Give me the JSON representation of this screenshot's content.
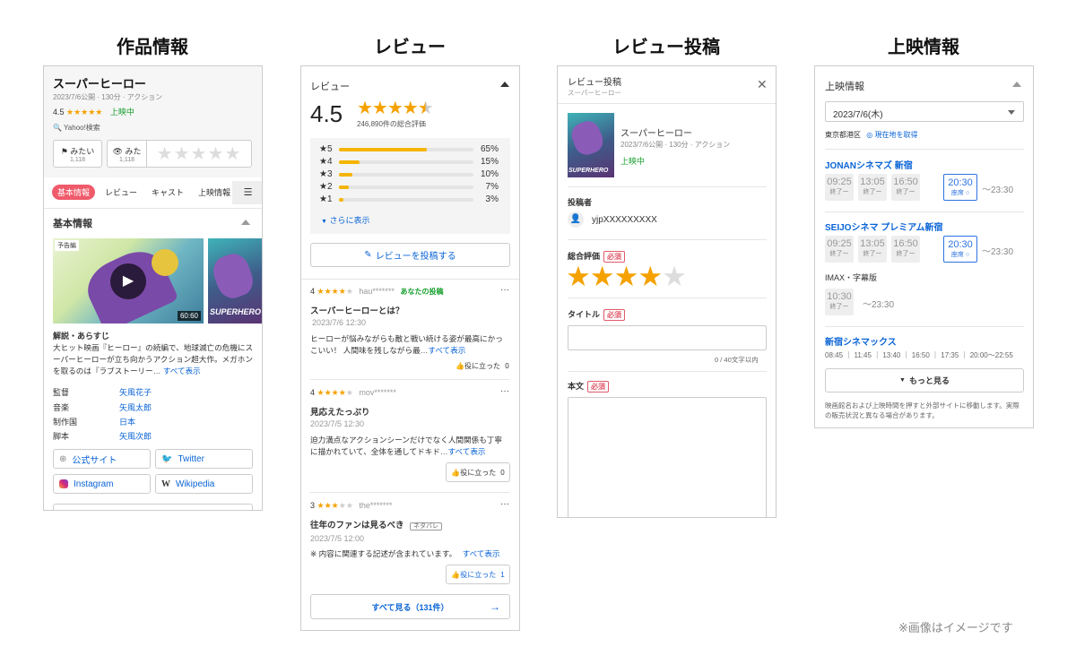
{
  "columns": {
    "info": "作品情報",
    "reviews": "レビュー",
    "post": "レビュー投稿",
    "showings": "上映情報"
  },
  "info_panel": {
    "title": "スーパーヒーロー",
    "meta": "2023/7/6公開 · 130分 · アクション",
    "rating": "4.5",
    "status": "上映中",
    "yahoo_search": "Yahoo!検索",
    "want_label": "みたい",
    "want_count": "1,118",
    "seen_label": "みた",
    "seen_count": "1,118",
    "tabs": [
      "基本情報",
      "レビュー",
      "キャスト",
      "上映情報"
    ],
    "section_title": "基本情報",
    "trailer_badge": "予告編",
    "duration": "60:60",
    "poster_text": "SUPERHERO",
    "synopsis_title": "解説・あらすじ",
    "synopsis": "大ヒット映画『ヒーロー』の続編で、地球滅亡の危機にスーパーヒーローが立ち向かうアクション超大作。メガホンを取るのは『ラブストーリー…",
    "show_all": "すべて表示",
    "credits": [
      {
        "role": "監督",
        "name": "矢風花子"
      },
      {
        "role": "音楽",
        "name": "矢風太郎"
      },
      {
        "role": "制作国",
        "name": "日本"
      },
      {
        "role": "脚本",
        "name": "矢風次郎"
      }
    ],
    "links": [
      "公式サイト",
      "Twitter",
      "Instagram",
      "Wikipedia"
    ]
  },
  "review_panel": {
    "header": "レビュー",
    "score": "4.5",
    "total": "246,890件の総合評価",
    "distribution": [
      {
        "label": "★5",
        "pct": 65,
        "text": "65%"
      },
      {
        "label": "★4",
        "pct": 15,
        "text": "15%"
      },
      {
        "label": "★3",
        "pct": 10,
        "text": "10%"
      },
      {
        "label": "★2",
        "pct": 7,
        "text": "7%"
      },
      {
        "label": "★1",
        "pct": 3,
        "text": "3%"
      }
    ],
    "more": "さらに表示",
    "post_button": "レビューを投稿する",
    "reviews": [
      {
        "score": "4",
        "stars": 4,
        "user": "hau*******",
        "tag": "あなたの投稿",
        "title": "スーパーヒーローとは？",
        "date": "2023/7/6 12:30",
        "body1": "ヒーローが悩みながらも敵と戦い続ける姿が最高にかっこいい！ 人間味を残しながら最…",
        "show_all": "すべて表示",
        "helpful": "役に立った",
        "helpful_count": "0"
      },
      {
        "score": "4",
        "stars": 4,
        "user": "mov*******",
        "tag": "",
        "title": "見応えたっぷり",
        "date": "2023/7/5 12:30",
        "body1": "迫力満点なアクションシーンだけでなく人間関係も丁寧に描かれていて、全体を通してドキド…",
        "show_all": "すべて表示",
        "helpful": "役に立った",
        "helpful_count": "0"
      },
      {
        "score": "3",
        "stars": 3,
        "user": "the*******",
        "tag": "ネタバレ",
        "title": "往年のファンは見るべき",
        "date": "2023/7/5 12:00",
        "body1": "※ 内容に関連する記述が含まれています。",
        "show_all": "すべて表示",
        "helpful": "役に立った",
        "helpful_count": "1"
      }
    ],
    "see_all": "すべて見る（131件）"
  },
  "post_panel": {
    "header": "レビュー投稿",
    "subheader": "スーパーヒーロー",
    "title": "スーパーヒーロー",
    "meta": "2023/7/6公開 · 130分 · アクション",
    "status": "上映中",
    "poster_text": "SUPERHERO",
    "author_label": "投稿者",
    "author": "yjpXXXXXXXXX",
    "rating_label": "総合評価",
    "required": "必須",
    "rating_stars": 4,
    "title_label": "タイトル",
    "counter": "0 / 40文字以内",
    "body_label": "本文"
  },
  "showing_panel": {
    "header": "上映情報",
    "date": "2023/7/6(木)",
    "location": "東京都港区",
    "geo": "現在地を取得",
    "theaters": [
      {
        "name": "JONANシネマズ 新宿",
        "times": [
          {
            "t": "09:25",
            "s": "終了ー",
            "on": false
          },
          {
            "t": "13:05",
            "s": "終了ー",
            "on": false
          },
          {
            "t": "16:50",
            "s": "終了ー",
            "on": false
          },
          {
            "t": "20:30",
            "s": "座席 ○",
            "on": true
          }
        ],
        "end": "〜23:30"
      },
      {
        "name": "SEIJOシネマ プレミアム新宿",
        "times": [
          {
            "t": "09:25",
            "s": "終了ー",
            "on": false
          },
          {
            "t": "13:05",
            "s": "終了ー",
            "on": false
          },
          {
            "t": "16:50",
            "s": "終了ー",
            "on": false
          },
          {
            "t": "20:30",
            "s": "座席 ○",
            "on": true
          }
        ],
        "end": "〜23:30"
      }
    ],
    "imax_label": "IMAX・字幕版",
    "imax_time": "10:30",
    "imax_sub": "終了ー",
    "imax_end": "〜23:30",
    "third_theater": "新宿シネマックス",
    "third_times": "08:45 ｜ 11:45 ｜ 13:40 ｜ 16:50 ｜ 17:35 ｜ 20:00〜22:55",
    "more": "もっと見る",
    "note": "映画館名および上映時間を押すと外部サイトに移動します。実際の販売状況と異なる場合があります。"
  },
  "footnote": "※画像はイメージです"
}
